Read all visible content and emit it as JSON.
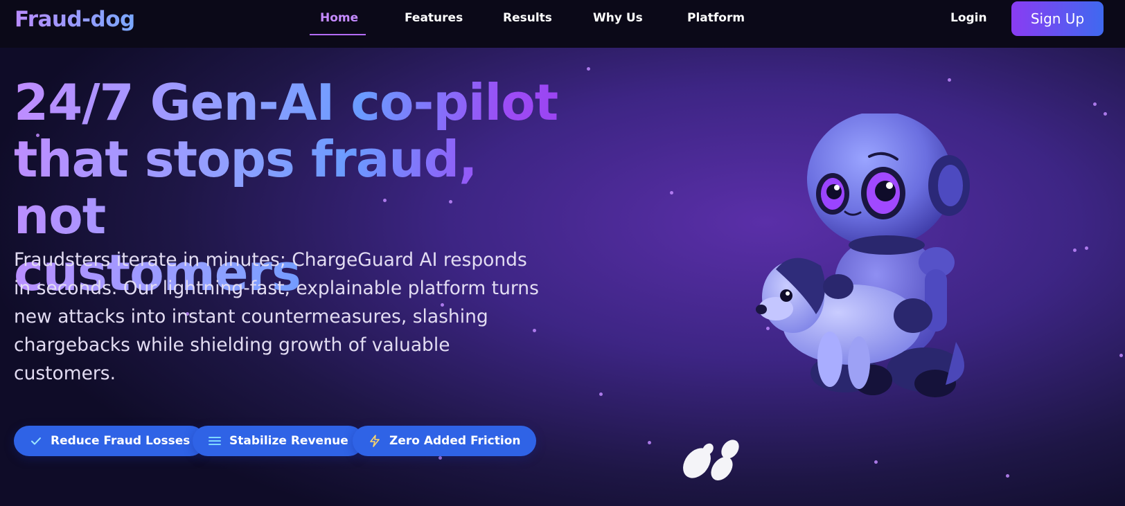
{
  "brand": {
    "name": "Fraud-dog"
  },
  "nav": {
    "links": [
      {
        "label": "Home",
        "active": true
      },
      {
        "label": "Features",
        "active": false
      },
      {
        "label": "Results",
        "active": false
      },
      {
        "label": "Why Us",
        "active": false
      },
      {
        "label": "Platform",
        "active": false
      }
    ],
    "login_label": "Login",
    "signup_label": "Sign Up"
  },
  "hero": {
    "headline_lines": [
      "24/7 Gen-AI co-pilot",
      "that stops fraud, not",
      "customers"
    ],
    "subtext": "Fraudsters iterate in minutes; ChargeGuard AI responds in seconds. Our lightning-fast, explainable platform turns new attacks into instant countermeasures, slashing chargebacks while shielding growth of valuable customers.",
    "pills": [
      {
        "label": "Reduce Fraud Losses",
        "icon": "check-icon"
      },
      {
        "label": "Stabilize Revenue",
        "icon": "menu-lines-icon"
      },
      {
        "label": "Zero Added Friction",
        "icon": "lightning-icon"
      }
    ]
  },
  "colors": {
    "accent_purple": "#8a3cf2",
    "accent_blue": "#3f69f0",
    "pill_blue": "#2f63e6",
    "nav_bg": "#0b0918"
  }
}
